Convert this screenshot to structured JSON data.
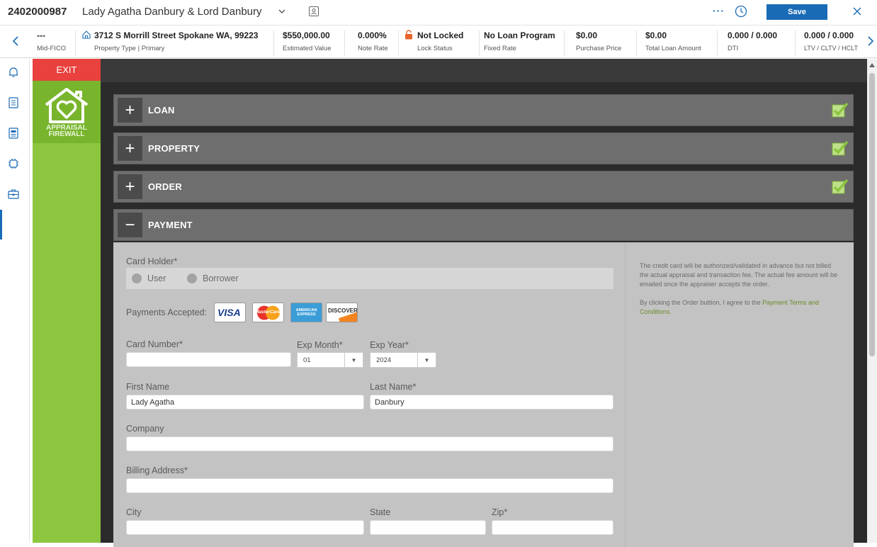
{
  "header": {
    "loan_number": "2402000987",
    "borrower_name": "Lady Agatha Danbury & Lord Danbury",
    "more_label": "···",
    "save_label": "Save"
  },
  "summary": {
    "fico": {
      "value": "---",
      "label": "Mid-FICO"
    },
    "property": {
      "value": "3712 S Morrill Street Spokane WA, 99223",
      "label": "Property Type | Primary"
    },
    "estimated_value": {
      "value": "$550,000.00",
      "label": "Estimated Value"
    },
    "note_rate": {
      "value": "0.000%",
      "label": "Note Rate"
    },
    "lock_status": {
      "value": "Not Locked",
      "label": "Lock Status"
    },
    "loan_program": {
      "value": "No Loan Program",
      "label": "Fixed Rate"
    },
    "purchase_price": {
      "value": "$0.00",
      "label": "Purchase Price"
    },
    "total_loan": {
      "value": "$0.00",
      "label": "Total Loan Amount"
    },
    "dti": {
      "value": "0.000 / 0.000",
      "label": "DTI"
    },
    "ltv": {
      "value": "0.000 / 0.000",
      "label": "LTV / CLTV / HCLT"
    }
  },
  "app": {
    "exit_label": "EXIT",
    "logo_line1": "APPRAISAL",
    "logo_line2": "FIREWALL",
    "sections": [
      {
        "title": "LOAN",
        "toggle": "+"
      },
      {
        "title": "PROPERTY",
        "toggle": "+"
      },
      {
        "title": "ORDER",
        "toggle": "+"
      },
      {
        "title": "PAYMENT",
        "toggle": "−"
      }
    ]
  },
  "payment": {
    "card_holder_label": "Card Holder*",
    "card_holder_options": [
      "User",
      "Borrower"
    ],
    "payments_accepted_label": "Payments Accepted:",
    "card_logos": {
      "visa": "VISA",
      "mastercard": "MasterCard",
      "amex": "AMERICAN EXPRESS",
      "discover": "DISCOVER"
    },
    "card_number_label": "Card Number*",
    "card_number_value": "",
    "exp_month_label": "Exp Month*",
    "exp_month_value": "01",
    "exp_year_label": "Exp Year*",
    "exp_year_value": "2024",
    "first_name_label": "First Name",
    "first_name_value": "Lady Agatha",
    "last_name_label": "Last Name*",
    "last_name_value": "Danbury",
    "company_label": "Company",
    "company_value": "",
    "billing_address_label": "Billing Address*",
    "billing_address_value": "",
    "city_label": "City",
    "state_label": "State",
    "zip_label": "Zip*",
    "notice_1": "The credit card will be authorized/validated in advance but not billed the actual appraisal and transaction fee. The actual fee amount will be emailed once the appraiser accepts the order.",
    "notice_2_prefix": "By clicking the Order buttion, I agree to the",
    "notice_2_link": "Payment Terms and Conditions",
    "notice_2_suffix": "."
  }
}
